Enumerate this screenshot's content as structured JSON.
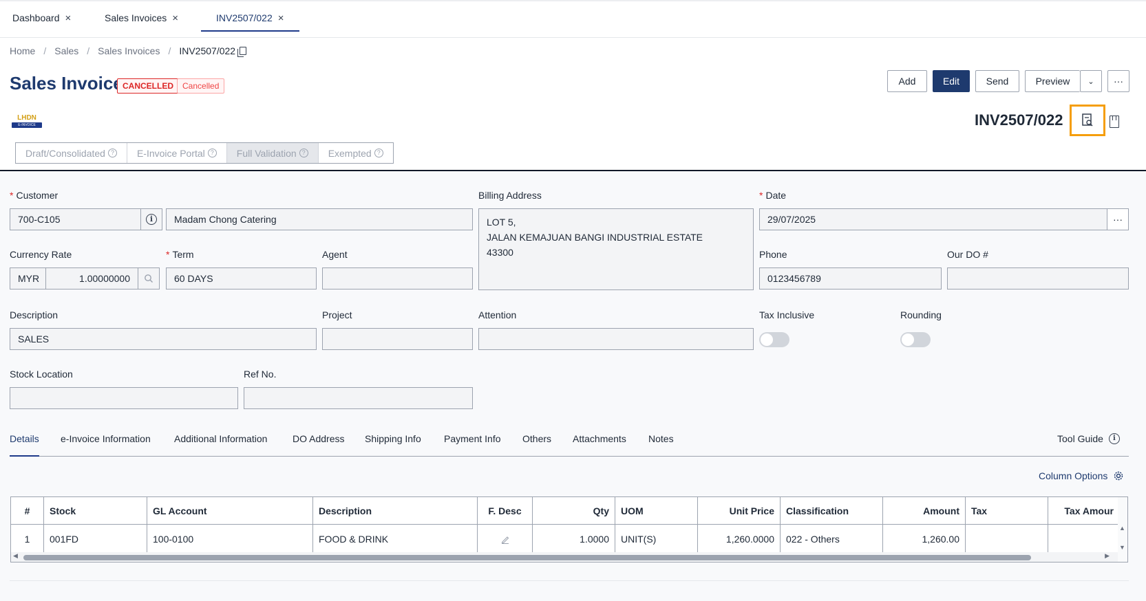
{
  "top_tabs": [
    {
      "label": "Dashboard"
    },
    {
      "label": "Sales Invoices"
    },
    {
      "label": "INV2507/022"
    }
  ],
  "breadcrumb": [
    "Home",
    "Sales",
    "Sales Invoices",
    "INV2507/022"
  ],
  "page": {
    "title": "Sales Invoice",
    "badge_status": "CANCELLED",
    "badge_secondary": "Cancelled",
    "doc_no": "INV2507/022"
  },
  "toolbar": {
    "add": "Add",
    "edit": "Edit",
    "send": "Send",
    "preview": "Preview",
    "more": "···"
  },
  "lhdn": {
    "logo_text": "LHDN",
    "logo_ribbon": "E-INVOICE",
    "segments": [
      "Draft/Consolidated",
      "E-Invoice Portal",
      "Full Validation",
      "Exempted"
    ],
    "selected": "Full Validation"
  },
  "form": {
    "customer_label": "Customer",
    "customer_code": "700-C105",
    "customer_name": "Madam Chong Catering",
    "billing_label": "Billing Address",
    "billing_lines": [
      "LOT 5,",
      "JALAN KEMAJUAN BANGI INDUSTRIAL ESTATE",
      "43300"
    ],
    "date_label": "Date",
    "date_value": "29/07/2025",
    "currency_label": "Currency Rate",
    "currency_code": "MYR",
    "currency_rate": "1.00000000",
    "term_label": "Term",
    "term_value": "60 DAYS",
    "agent_label": "Agent",
    "agent_value": "",
    "phone_label": "Phone",
    "phone_value": "0123456789",
    "our_do_label": "Our DO #",
    "our_do_value": "",
    "description_label": "Description",
    "description_value": "SALES",
    "project_label": "Project",
    "project_value": "",
    "attention_label": "Attention",
    "attention_value": "",
    "tax_inclusive_label": "Tax Inclusive",
    "tax_inclusive_on": false,
    "rounding_label": "Rounding",
    "rounding_on": false,
    "stock_location_label": "Stock Location",
    "stock_location_value": "",
    "ref_no_label": "Ref No.",
    "ref_no_value": ""
  },
  "detail_tabs": [
    "Details",
    "e-Invoice Information",
    "Additional Information",
    "DO Address",
    "Shipping Info",
    "Payment Info",
    "Others",
    "Attachments",
    "Notes"
  ],
  "tool_guide": "Tool Guide",
  "column_options": "Column Options",
  "table": {
    "columns": [
      "#",
      "Stock",
      "GL Account",
      "Description",
      "F. Desc",
      "Qty",
      "UOM",
      "Unit Price",
      "Classification",
      "Amount",
      "Tax",
      "Tax Amour"
    ],
    "rows": [
      [
        "1",
        "001FD",
        "100-0100",
        "FOOD & DRINK",
        "",
        "1.0000",
        "UNIT(S)",
        "1,260.0000",
        "022 - Others",
        "1,260.00",
        "",
        ""
      ]
    ]
  },
  "colors": {
    "brand": "#1e3a6e",
    "danger": "#dc2626",
    "highlight": "#f59e0b"
  }
}
